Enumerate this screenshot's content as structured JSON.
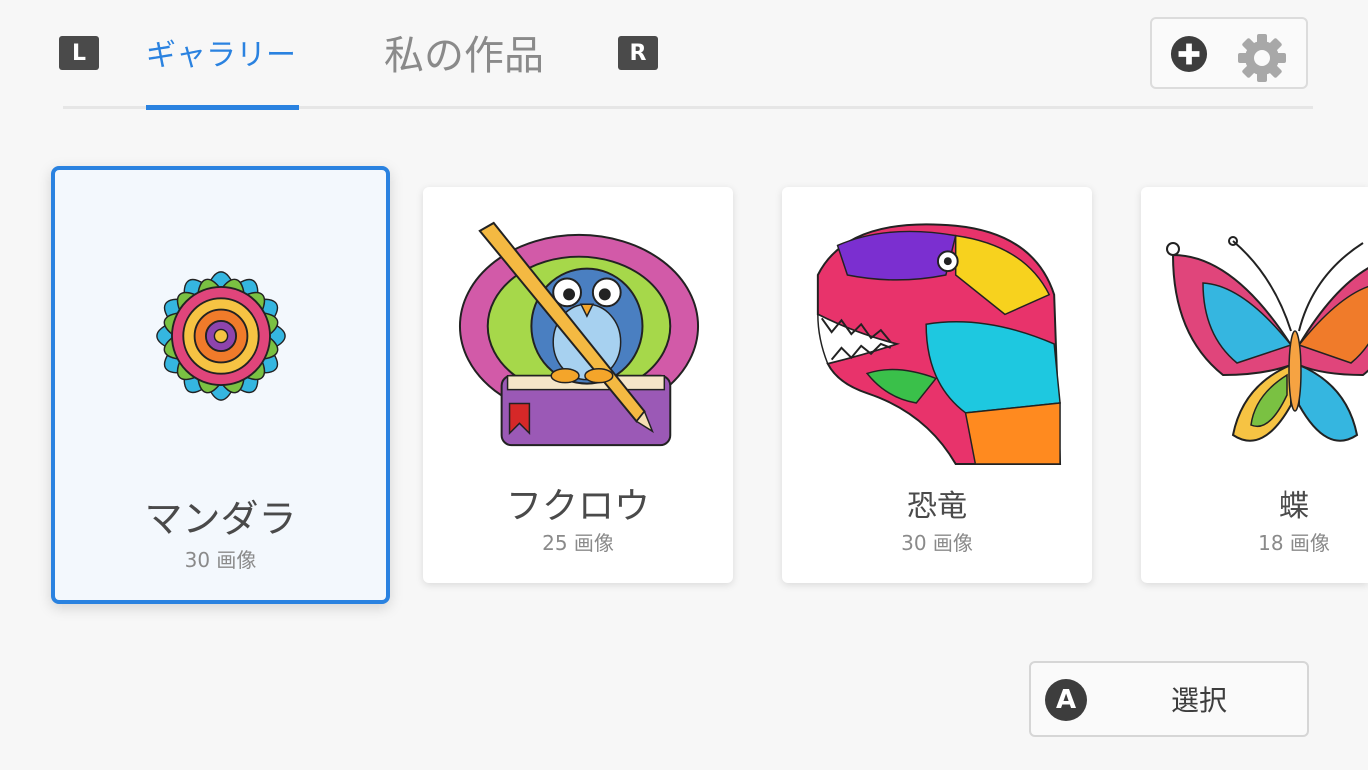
{
  "nav": {
    "left_shoulder": "L",
    "right_shoulder": "R",
    "tabs": [
      {
        "label": "ギャラリー",
        "active": true
      },
      {
        "label": "私の作品",
        "active": false
      }
    ]
  },
  "toolbar": {
    "add_icon": "plus-circle-icon",
    "settings_icon": "gear-icon"
  },
  "gallery": {
    "cards": [
      {
        "title": "マンダラ",
        "count": "30 画像",
        "selected": true,
        "icon": "mandala"
      },
      {
        "title": "フクロウ",
        "count": "25 画像",
        "selected": false,
        "icon": "owl"
      },
      {
        "title": "恐竜",
        "count": "30 画像",
        "selected": false,
        "icon": "dinosaur"
      },
      {
        "title": "蝶",
        "count": "18 画像",
        "selected": false,
        "icon": "butterfly"
      }
    ]
  },
  "footer": {
    "select_button": {
      "icon_glyph": "A",
      "label": "選択"
    }
  },
  "colors": {
    "accent": "#2a82e0",
    "card_bg": "#ffffff",
    "page_bg": "#f7f7f7"
  }
}
